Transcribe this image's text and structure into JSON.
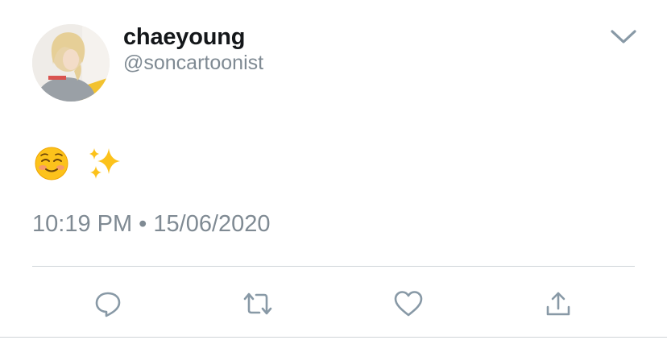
{
  "tweet": {
    "author": {
      "display_name": "chaeyoung",
      "handle": "@soncartoonist"
    },
    "text": "☺️✨",
    "emojis": [
      "smiling-face",
      "sparkles"
    ],
    "timestamp": "10:19 PM • 15/06/2020"
  },
  "icons": {
    "menu": "chevron-down-icon",
    "reply": "reply-icon",
    "retweet": "retweet-icon",
    "like": "heart-icon",
    "share": "share-icon"
  },
  "colors": {
    "text_primary": "#14171a",
    "text_secondary": "#7f8a93",
    "icon": "#8899a6",
    "divider": "#cfd4d8"
  }
}
